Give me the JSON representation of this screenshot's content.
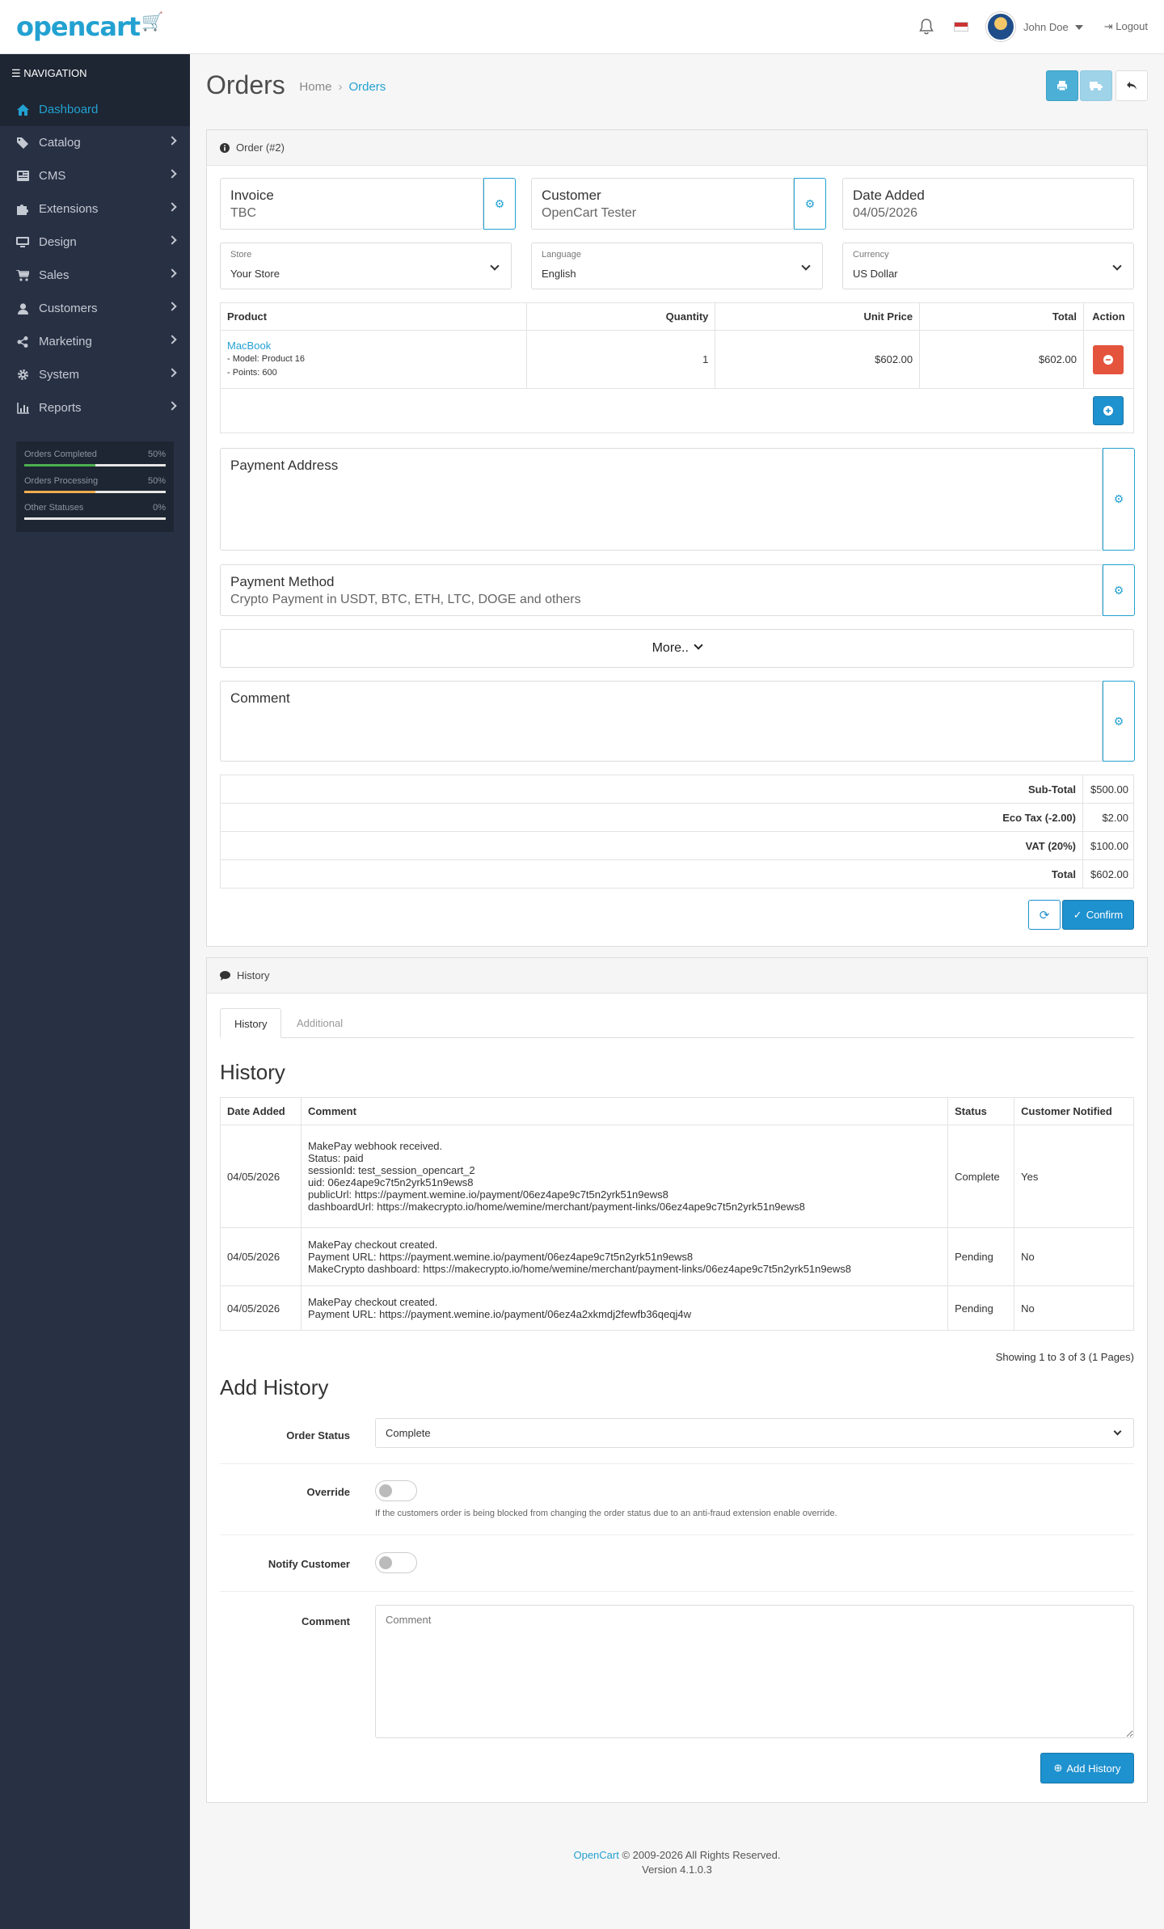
{
  "header": {
    "logo": "opencart",
    "user": "John Doe",
    "logout": "Logout"
  },
  "nav": {
    "title": "NAVIGATION",
    "items": [
      {
        "label": "Dashboard",
        "icon": "home-icon",
        "active": true
      },
      {
        "label": "Catalog",
        "icon": "tag-icon"
      },
      {
        "label": "CMS",
        "icon": "newspaper-icon"
      },
      {
        "label": "Extensions",
        "icon": "puzzle-icon"
      },
      {
        "label": "Design",
        "icon": "monitor-icon"
      },
      {
        "label": "Sales",
        "icon": "cart-icon"
      },
      {
        "label": "Customers",
        "icon": "user-icon"
      },
      {
        "label": "Marketing",
        "icon": "share-icon"
      },
      {
        "label": "System",
        "icon": "gear-icon"
      },
      {
        "label": "Reports",
        "icon": "bar-chart-icon"
      }
    ],
    "stats": [
      {
        "label": "Orders Completed",
        "value": "50%",
        "fill": 0.5,
        "color": "#4caf50"
      },
      {
        "label": "Orders Processing",
        "value": "50%",
        "fill": 0.5,
        "color": "#f0ad4e"
      },
      {
        "label": "Other Statuses",
        "value": "0%",
        "fill": 0,
        "color": "#e4533c"
      }
    ]
  },
  "page": {
    "title": "Orders",
    "breadcrumb": [
      "Home",
      "Orders"
    ]
  },
  "order": {
    "card_title": "Order (#2)",
    "invoice": {
      "label": "Invoice",
      "value": "TBC"
    },
    "customer": {
      "label": "Customer",
      "value": "OpenCart Tester"
    },
    "date_added": {
      "label": "Date Added",
      "value": "04/05/2026"
    },
    "store": {
      "label": "Store",
      "value": "Your Store"
    },
    "language": {
      "label": "Language",
      "value": "English"
    },
    "currency": {
      "label": "Currency",
      "value": "US Dollar"
    },
    "columns": [
      "Product",
      "Quantity",
      "Unit Price",
      "Total",
      "Action"
    ],
    "product": {
      "name": "MacBook",
      "model": "- Model: Product 16",
      "points": "- Points: 600",
      "quantity": "1",
      "unit_price": "$602.00",
      "total": "$602.00"
    },
    "payment_address": {
      "label": "Payment Address"
    },
    "payment_method": {
      "label": "Payment Method",
      "value": "Crypto Payment in USDT, BTC, ETH, LTC, DOGE and others"
    },
    "more": "More..",
    "comment": {
      "label": "Comment"
    },
    "totals": [
      {
        "label": "Sub-Total",
        "value": "$500.00"
      },
      {
        "label": "Eco Tax (-2.00)",
        "value": "$2.00"
      },
      {
        "label": "VAT (20%)",
        "value": "$100.00"
      },
      {
        "label": "Total",
        "value": "$602.00"
      }
    ],
    "confirm": "Confirm"
  },
  "history": {
    "card_title": "History",
    "tabs": [
      "History",
      "Additional"
    ],
    "heading": "History",
    "columns": [
      "Date Added",
      "Comment",
      "Status",
      "Customer Notified"
    ],
    "rows": [
      {
        "date": "04/05/2026",
        "comment": [
          "MakePay webhook received.",
          "Status: paid",
          "sessionId: test_session_opencart_2",
          "uid: 06ez4ape9c7t5n2yrk51n9ews8",
          "publicUrl: https://payment.wemine.io/payment/06ez4ape9c7t5n2yrk51n9ews8",
          "dashboardUrl: https://makecrypto.io/home/wemine/merchant/payment-links/06ez4ape9c7t5n2yrk51n9ews8"
        ],
        "status": "Complete",
        "notified": "Yes"
      },
      {
        "date": "04/05/2026",
        "comment": [
          "MakePay checkout created.",
          "Payment URL: https://payment.wemine.io/payment/06ez4ape9c7t5n2yrk51n9ews8",
          "MakeCrypto dashboard: https://makecrypto.io/home/wemine/merchant/payment-links/06ez4ape9c7t5n2yrk51n9ews8"
        ],
        "status": "Pending",
        "notified": "No"
      },
      {
        "date": "04/05/2026",
        "comment": [
          "MakePay checkout created.",
          "Payment URL: https://payment.wemine.io/payment/06ez4a2xkmdj2fewfb36qeqj4w"
        ],
        "status": "Pending",
        "notified": "No"
      }
    ],
    "pagination": "Showing 1 to 3 of 3 (1 Pages)",
    "add_heading": "Add History",
    "order_status": {
      "label": "Order Status",
      "value": "Complete"
    },
    "override": {
      "label": "Override",
      "help": "If the customers order is being blocked from changing the order status due to an anti-fraud extension enable override."
    },
    "notify": {
      "label": "Notify Customer"
    },
    "comment": {
      "label": "Comment",
      "placeholder": "Comment"
    },
    "add_button": "Add History"
  },
  "footer": {
    "link": "OpenCart",
    "copyright": "© 2009-2026 All Rights Reserved.",
    "version": "Version 4.1.0.3"
  }
}
